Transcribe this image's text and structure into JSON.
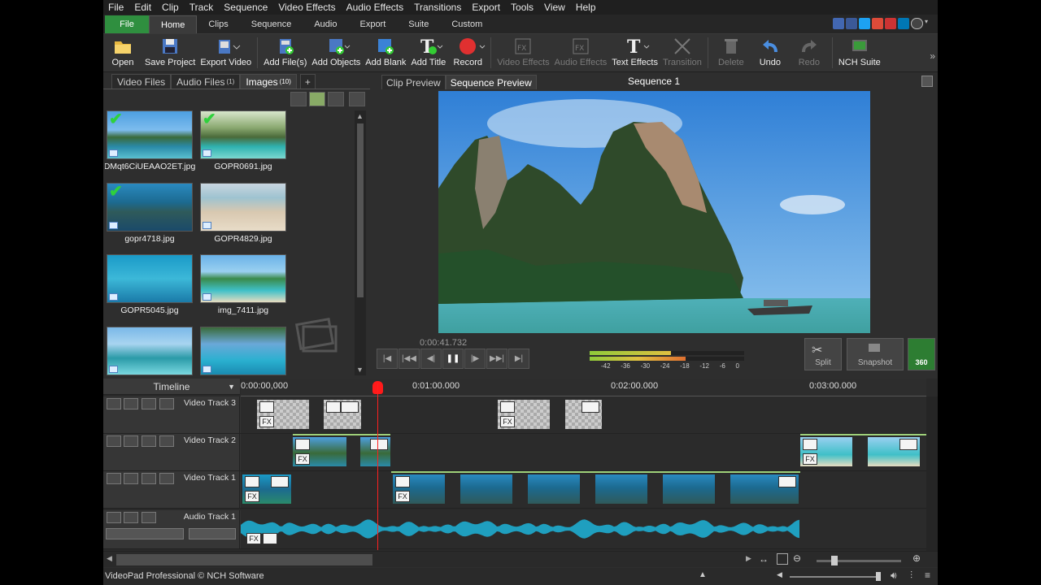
{
  "menu": [
    "File",
    "Edit",
    "Clip",
    "Track",
    "Sequence",
    "Video Effects",
    "Audio Effects",
    "Transitions",
    "Export",
    "Tools",
    "View",
    "Help"
  ],
  "tabs": {
    "file": "File",
    "items": [
      "Home",
      "Clips",
      "Sequence",
      "Audio",
      "Export",
      "Suite",
      "Custom"
    ]
  },
  "toolbar": {
    "open": "Open",
    "save_project": "Save Project",
    "export_video": "Export Video",
    "add_files": "Add File(s)",
    "add_objects": "Add Objects",
    "add_blank": "Add Blank",
    "add_title": "Add Title",
    "record": "Record",
    "video_effects": "Video Effects",
    "audio_effects": "Audio Effects",
    "text_effects": "Text Effects",
    "transition": "Transition",
    "delete": "Delete",
    "undo": "Undo",
    "redo": "Redo",
    "nch_suite": "NCH Suite"
  },
  "media": {
    "tabs": {
      "video": "Video Files",
      "audio": "Audio Files",
      "audio_count": "(1)",
      "images": "Images",
      "images_count": "(10)",
      "plus": "+"
    },
    "files": [
      "DMqt6CiUEAAO2ET.jpg",
      "GOPR0691.jpg",
      "gopr4718.jpg",
      "GOPR4829.jpg",
      "GOPR5045.jpg",
      "img_7411.jpg"
    ]
  },
  "preview": {
    "clip_tab": "Clip Preview",
    "seq_tab": "Sequence Preview",
    "title": "Sequence 1",
    "timecode": "0:00:41.732",
    "split": "Split",
    "snapshot": "Snapshot",
    "b360": "360",
    "meter_ticks": [
      "-42",
      "-36",
      "-30",
      "-24",
      "-18",
      "-12",
      "-6",
      "0"
    ]
  },
  "timeline": {
    "label": "Timeline",
    "ruler": [
      "0:00:00,000",
      "0:01:00.000",
      "0:02:00.000",
      "0:03:00.000"
    ],
    "tracks": {
      "v3": "Video Track 3",
      "v2": "Video Track 2",
      "v1": "Video Track 1",
      "a1": "Audio Track 1"
    }
  },
  "status": "VideoPad Professional © NCH Software",
  "colors": {
    "accent_green": "#2f8f3f",
    "playhead": "#ff2020",
    "wave": "#1f9fbf"
  }
}
